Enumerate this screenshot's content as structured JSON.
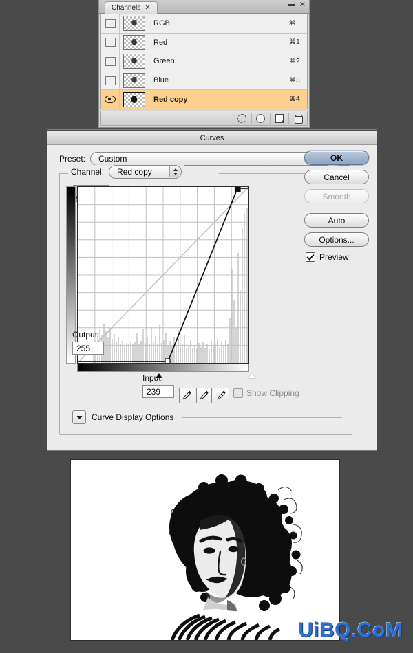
{
  "channels_panel": {
    "tab_label": "Channels",
    "tab_close_icon": "close-x-icon",
    "minimize_icon": "minimize-icon",
    "close_icon": "close-icon",
    "menu_icon": "panel-menu-icon",
    "rows": [
      {
        "name": "RGB",
        "shortcut": "⌘~",
        "visible": false,
        "selected": false
      },
      {
        "name": "Red",
        "shortcut": "⌘1",
        "visible": false,
        "selected": false
      },
      {
        "name": "Green",
        "shortcut": "⌘2",
        "visible": false,
        "selected": false
      },
      {
        "name": "Blue",
        "shortcut": "⌘3",
        "visible": false,
        "selected": false
      },
      {
        "name": "Red copy",
        "shortcut": "⌘4",
        "visible": true,
        "selected": true
      }
    ],
    "footer_buttons": [
      "load-channel-as-selection-icon",
      "save-selection-as-channel-icon",
      "new-channel-icon",
      "delete-channel-icon"
    ],
    "selected_row_color": "#fcd08f"
  },
  "curves_dialog": {
    "title": "Curves",
    "preset": {
      "label": "Preset:",
      "value": "Custom",
      "menu_icon": "preset-menu-icon"
    },
    "channel": {
      "label": "Channel:",
      "value": "Red copy"
    },
    "tools": {
      "curve_tool_icon": "curve-draw-icon",
      "pencil_tool_icon": "pencil-icon",
      "selected": "curve-draw-icon"
    },
    "output": {
      "label": "Output:",
      "value": "255"
    },
    "input": {
      "label": "Input:",
      "value": "239"
    },
    "eyedroppers": [
      "black-point-eyedropper-icon",
      "gray-point-eyedropper-icon",
      "white-point-eyedropper-icon"
    ],
    "show_clipping": {
      "label": "Show Clipping",
      "checked": false
    },
    "curve_display_options": {
      "label": "Curve Display Options",
      "expanded": false
    },
    "buttons": {
      "ok": "OK",
      "cancel": "Cancel",
      "smooth": "Smooth",
      "auto": "Auto",
      "options": "Options..."
    },
    "preview": {
      "label": "Preview",
      "checked": true
    },
    "accent_color": "#8ea4c2"
  },
  "curve_data": {
    "type": "line",
    "xlabel": "Input",
    "ylabel": "Output",
    "xlim": [
      0,
      255
    ],
    "ylim": [
      0,
      255
    ],
    "grid": true,
    "grid_divisions": 10,
    "baseline_diagonal": true,
    "points": [
      {
        "input": 0,
        "output": 0
      },
      {
        "input": 135,
        "output": 0
      },
      {
        "input": 239,
        "output": 255
      },
      {
        "input": 255,
        "output": 255
      }
    ],
    "selected_point": {
      "input": 239,
      "output": 255
    },
    "black_slider": 135,
    "white_slider": 239,
    "histogram_note": "image histogram shown in light gray behind the curve"
  },
  "photo": {
    "description": "high-contrast black and white portrait of a woman with curly hair on white background"
  },
  "watermark": {
    "text": "UiBQ.CoM",
    "color": "#2f6fd0"
  }
}
